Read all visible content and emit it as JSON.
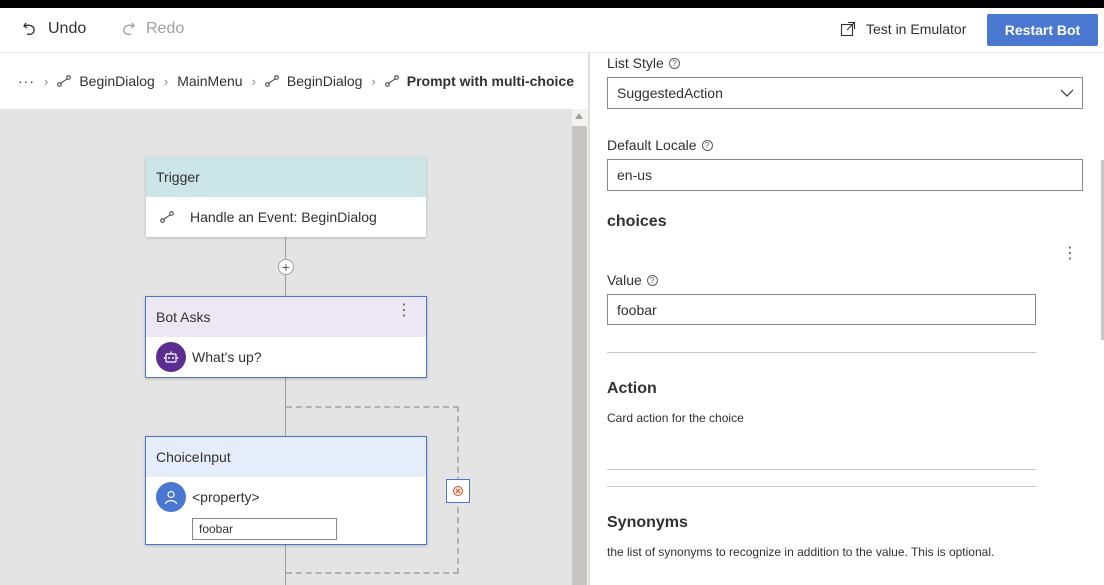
{
  "toolbar": {
    "undo_label": "Undo",
    "redo_label": "Redo",
    "emulator_label": "Test in Emulator",
    "restart_label": "Restart Bot"
  },
  "breadcrumb": {
    "overflow": "···",
    "items": [
      "BeginDialog",
      "MainMenu",
      "BeginDialog"
    ],
    "current": "Prompt with multi-choice"
  },
  "canvas": {
    "trigger": {
      "title": "Trigger",
      "event": "Handle an Event: BeginDialog"
    },
    "bot_asks": {
      "title": "Bot Asks",
      "message": "What's up?"
    },
    "choice_input": {
      "title": "ChoiceInput",
      "property": "<property>",
      "value": "foobar"
    }
  },
  "panel": {
    "list_style_label": "List Style",
    "list_style_value": "SuggestedAction",
    "default_locale_label": "Default Locale",
    "default_locale_value": "en-us",
    "choices_title": "choices",
    "value_label": "Value",
    "value_value": "foobar",
    "action_title": "Action",
    "action_desc": "Card action for the choice",
    "synonyms_title": "Synonyms",
    "synonyms_desc": "the list of synonyms to recognize in addition to the value. This is optional."
  },
  "colors": {
    "accent": "#4a78d0",
    "trigger_header": "#cce6e8",
    "bot_asks_header": "#ebe7f3",
    "choice_header": "#e6edfa",
    "bot_avatar": "#5c2d91"
  },
  "icons": [
    "undo-icon",
    "redo-icon",
    "open-external-icon",
    "event-icon",
    "chevron-down-icon",
    "bot-icon",
    "user-icon",
    "help-icon",
    "more-icon",
    "loop-icon"
  ]
}
